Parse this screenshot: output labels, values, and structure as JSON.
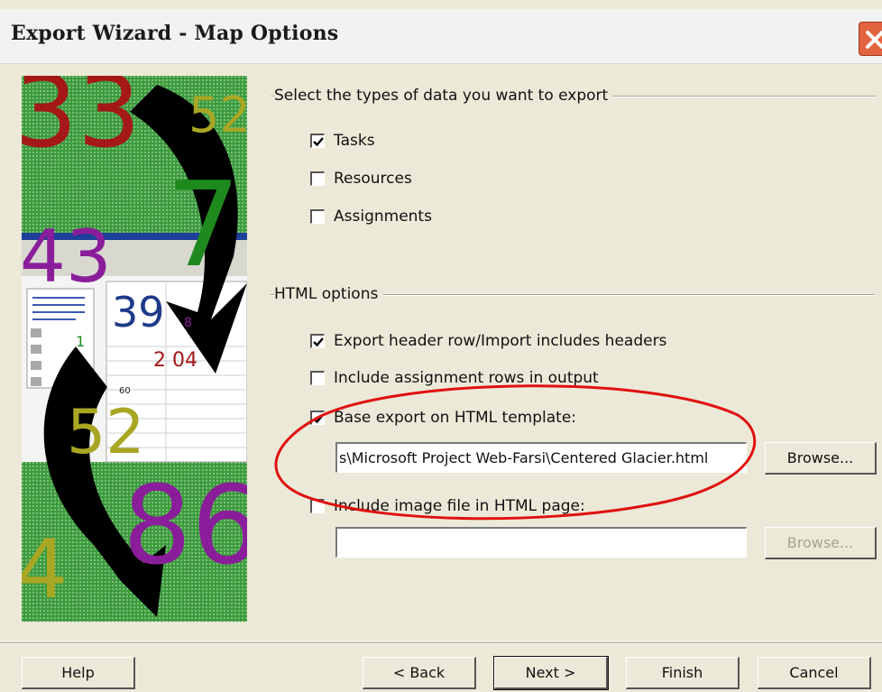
{
  "window": {
    "title": "Export Wizard - Map Options"
  },
  "art": {
    "labels": [
      "33",
      "52",
      "7",
      "43",
      "39",
      "8",
      "1",
      "2 04",
      "60",
      "52",
      "86",
      "4"
    ]
  },
  "data_types": {
    "title": "Select the types of data you want to export",
    "items": [
      {
        "label": "Tasks",
        "checked": true
      },
      {
        "label": "Resources",
        "checked": false
      },
      {
        "label": "Assignments",
        "checked": false
      }
    ]
  },
  "html_options": {
    "title": "HTML options",
    "export_header": {
      "label": "Export header row/Import includes headers",
      "checked": true
    },
    "include_assignment": {
      "label": "Include assignment rows in output",
      "checked": false
    },
    "base_template": {
      "label": "Base export on HTML template:",
      "checked": true
    },
    "template_path": "s\\Microsoft Project Web-Farsi\\Centered Glacier.html",
    "browse_label": "Browse...",
    "include_image": {
      "label": "Include image file in HTML page:",
      "checked": false
    },
    "image_path": "",
    "browse2_label": "Browse..."
  },
  "buttons": {
    "help": "Help",
    "back": "< Back",
    "next": "Next >",
    "finish": "Finish",
    "cancel": "Cancel"
  },
  "colors": {
    "dialog_bg": "#ece9d8",
    "annotation_red": "#e01010",
    "art_green": "#3e9a3e"
  }
}
